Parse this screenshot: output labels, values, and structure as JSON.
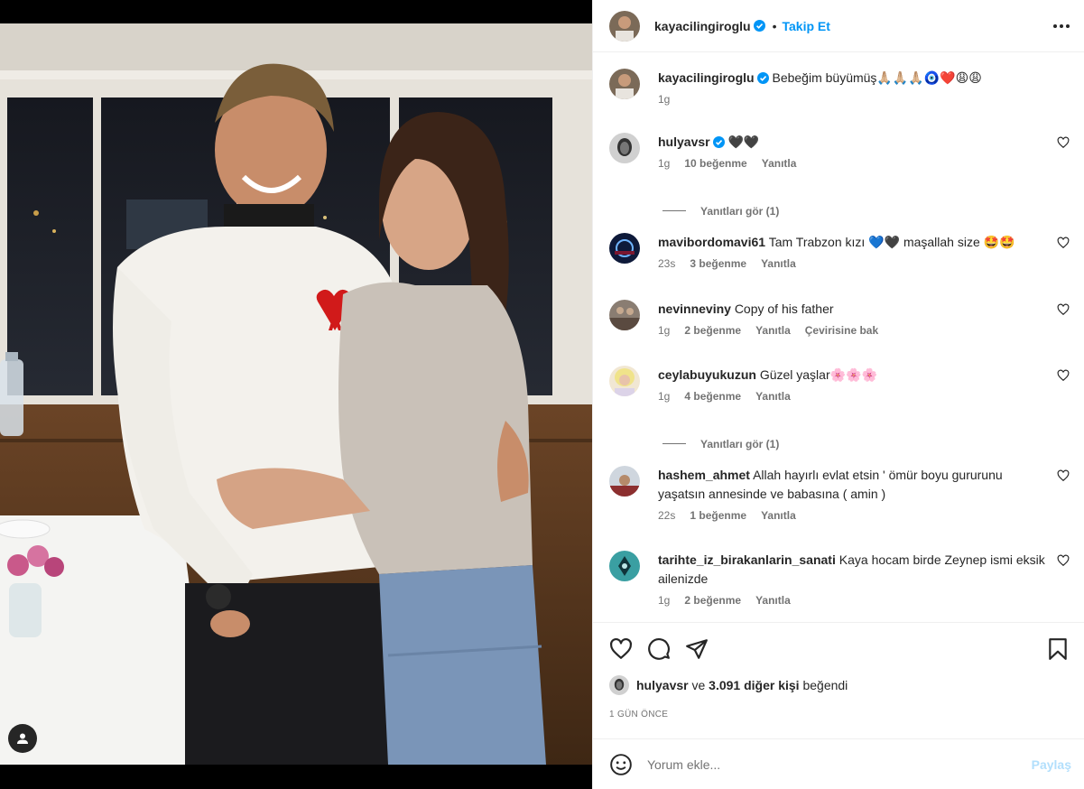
{
  "post": {
    "author": "kayacilingiroglu",
    "follow_label": "Takip Et",
    "caption": "Bebeğim büyümüş🙏🏼🙏🏼🙏🏼🧿❤️😩😩",
    "caption_time": "1g"
  },
  "comments": [
    {
      "user": "hulyavsr",
      "verified": true,
      "text": "🖤🖤",
      "time": "1g",
      "likes": "10 beğenme",
      "reply": "Yanıtla",
      "translate": ""
    },
    {
      "user": "mavibordomavi61",
      "verified": false,
      "text": "Tam Trabzon kızı 💙🖤 maşallah size 🤩🤩",
      "time": "23s",
      "likes": "3 beğenme",
      "reply": "Yanıtla",
      "translate": ""
    },
    {
      "user": "nevinneviny",
      "verified": false,
      "text": "Copy of his father",
      "time": "1g",
      "likes": "2 beğenme",
      "reply": "Yanıtla",
      "translate": "Çevirisine bak"
    },
    {
      "user": "ceylabuyukuzun",
      "verified": false,
      "text": "Güzel yaşlar🌸🌸🌸",
      "time": "1g",
      "likes": "4 beğenme",
      "reply": "Yanıtla",
      "translate": ""
    },
    {
      "user": "hashem_ahmet",
      "verified": false,
      "text": "Allah hayırlı evlat etsin ' ömür boyu gururunu yaşatsın annesinde ve babasına ( amin )",
      "time": "22s",
      "likes": "1 beğenme",
      "reply": "Yanıtla",
      "translate": ""
    },
    {
      "user": "tarihte_iz_birakanlarin_sanati",
      "verified": false,
      "text": "Kaya hocam birde Zeynep ismi eksik ailenizde",
      "time": "1g",
      "likes": "2 beğenme",
      "reply": "Yanıtla",
      "translate": ""
    }
  ],
  "view_replies": [
    "Yanıtları gör (1)",
    "Yanıtları gör (1)"
  ],
  "likes_line": {
    "user": "hulyavsr",
    "connector": "ve",
    "others": "3.091 diğer kişi",
    "suffix": "beğendi"
  },
  "post_date": "1 GÜN ÖNCE",
  "comment_box": {
    "placeholder": "Yorum ekle...",
    "post_label": "Paylaş"
  },
  "icons": {
    "like": "heart-icon",
    "comment": "comment-icon",
    "share": "share-icon",
    "save": "bookmark-icon",
    "more": "more-icon",
    "tag": "user-tag-icon",
    "emoji": "emoji-icon"
  },
  "colors": {
    "accent": "#0095f6",
    "verified": "#0095f6",
    "post_disabled": "#b2dffc",
    "muted": "#737373"
  }
}
